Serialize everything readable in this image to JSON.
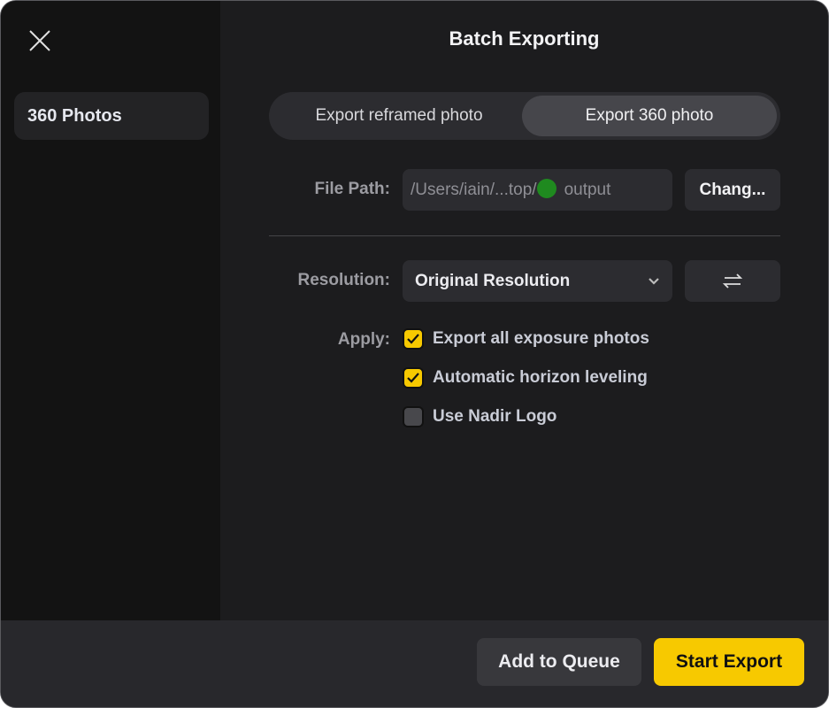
{
  "window": {
    "title": "Batch Exporting"
  },
  "sidebar": {
    "items": [
      {
        "label": "360 Photos",
        "selected": true
      }
    ]
  },
  "export_mode": {
    "options": [
      "Export reframed photo",
      "Export 360 photo"
    ],
    "selected": "Export 360 photo"
  },
  "file_path": {
    "label": "File Path:",
    "value_prefix": "/Users/iain/...top/",
    "value_suffix": "output",
    "change_label": "Chang..."
  },
  "resolution": {
    "label": "Resolution:",
    "selected": "Original Resolution",
    "swap_icon": "swap-arrows-icon"
  },
  "apply": {
    "label": "Apply:",
    "options": [
      {
        "label": "Export all exposure photos",
        "checked": true
      },
      {
        "label": "Automatic horizon leveling",
        "checked": true
      },
      {
        "label": "Use Nadir Logo",
        "checked": false
      }
    ]
  },
  "footer": {
    "add_to_queue": "Add to Queue",
    "start_export": "Start Export"
  },
  "colors": {
    "accent": "#f7c900",
    "folder_dot": "#1f8a1f"
  }
}
